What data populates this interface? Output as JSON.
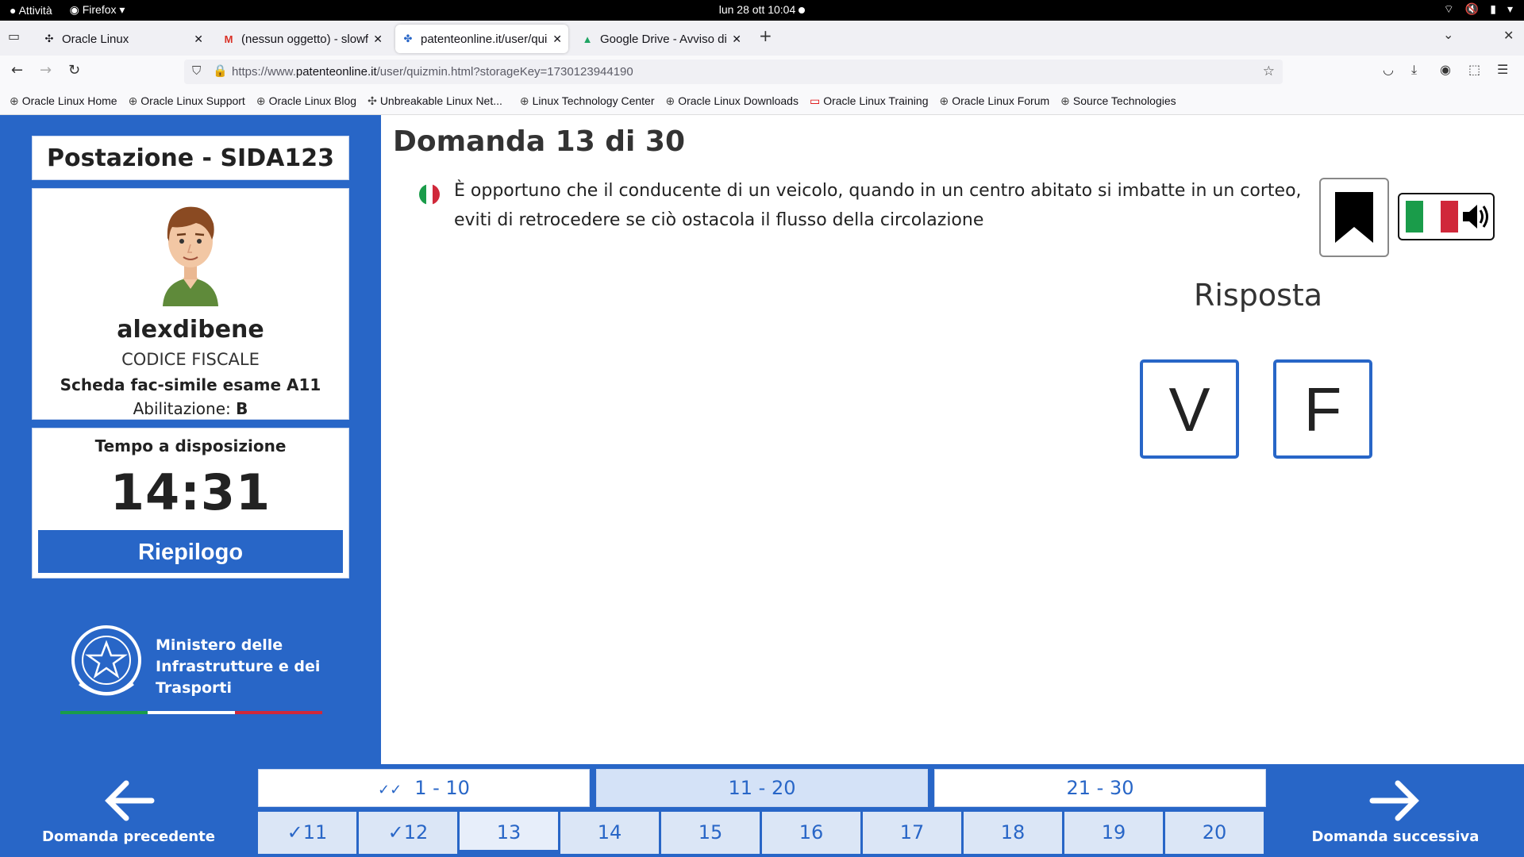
{
  "os_bar": {
    "activities": "Attività",
    "app": "Firefox",
    "clock": "lun 28 ott  10:04"
  },
  "tabs": [
    {
      "title": "Oracle Linux",
      "icon": "oracle-icon"
    },
    {
      "title": "(nessun oggetto) - slowfe",
      "icon": "gmail-icon"
    },
    {
      "title": "patenteonline.it/user/quiz",
      "icon": "patente-icon"
    },
    {
      "title": "Google Drive - Avviso di s",
      "icon": "drive-icon"
    }
  ],
  "url": {
    "prefix": "https://www.",
    "domain": "patenteonline.it",
    "path": "/user/quizmin.html?storageKey=1730123944190"
  },
  "bookmarks": [
    "Oracle Linux Home",
    "Oracle Linux Support",
    "Oracle Linux Blog",
    "Unbreakable Linux Net...",
    "Linux Technology Center",
    "Oracle Linux Downloads",
    "Oracle Linux Training",
    "Oracle Linux Forum",
    "Source Technologies"
  ],
  "sidebar": {
    "station": "Postazione - SIDA123",
    "username": "alexdibene",
    "codice_fiscale": "CODICE FISCALE",
    "scheda": "Scheda fac-simile esame A11",
    "abilitazione_label": "Abilitazione: ",
    "abilitazione_value": "B",
    "time_label": "Tempo a disposizione",
    "time_value": "14:31",
    "summary_button": "Riepilogo",
    "ministry": [
      "Ministero delle",
      "Infrastrutture e dei",
      "Trasporti"
    ]
  },
  "question": {
    "title": "Domanda 13 di 30",
    "text": "È opportuno che il conducente di un veicolo, quando in un centro abitato si imbatte in un corteo, eviti di retrocedere se ciò ostacola il flusso della circolazione",
    "answer_title": "Risposta",
    "true_label": "V",
    "false_label": "F"
  },
  "nav": {
    "prev": "Domanda precedente",
    "next": "Domanda successiva",
    "ranges": [
      "1 - 10",
      "11 - 20",
      "21 - 30"
    ],
    "numbers": [
      "11",
      "12",
      "13",
      "14",
      "15",
      "16",
      "17",
      "18",
      "19",
      "20"
    ],
    "check": "✓"
  },
  "colors": {
    "primary": "#2866c7"
  }
}
